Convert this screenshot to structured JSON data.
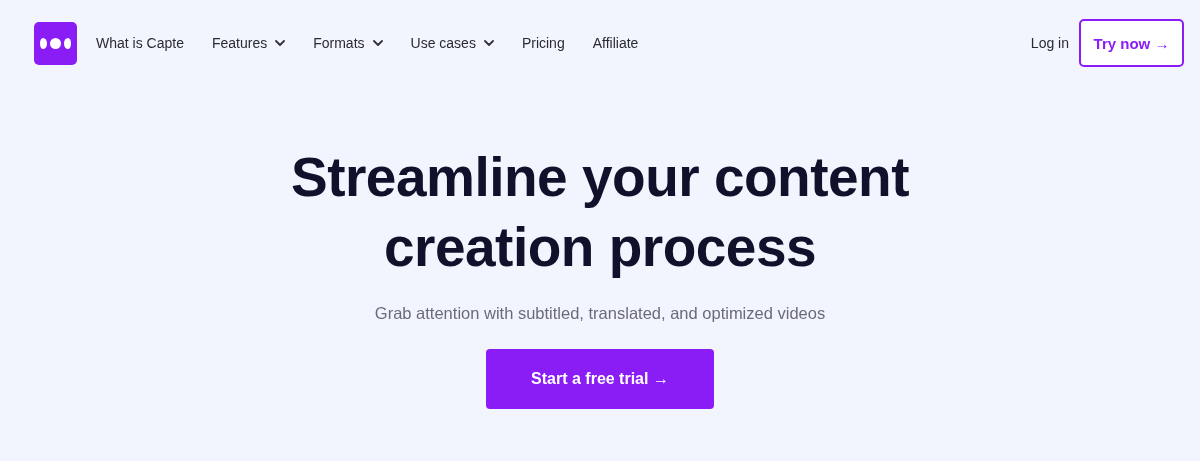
{
  "nav": {
    "items": [
      {
        "label": "What is Capte",
        "has_dropdown": false
      },
      {
        "label": "Features",
        "has_dropdown": true
      },
      {
        "label": "Formats",
        "has_dropdown": true
      },
      {
        "label": "Use cases",
        "has_dropdown": true
      },
      {
        "label": "Pricing",
        "has_dropdown": false
      },
      {
        "label": "Affiliate",
        "has_dropdown": false
      }
    ],
    "login": "Log in",
    "try_button": "Try now →"
  },
  "hero": {
    "title": "Streamline your content creation process",
    "subtitle": "Grab attention with subtitled, translated, and optimized videos",
    "cta": "Start a free trial →"
  }
}
